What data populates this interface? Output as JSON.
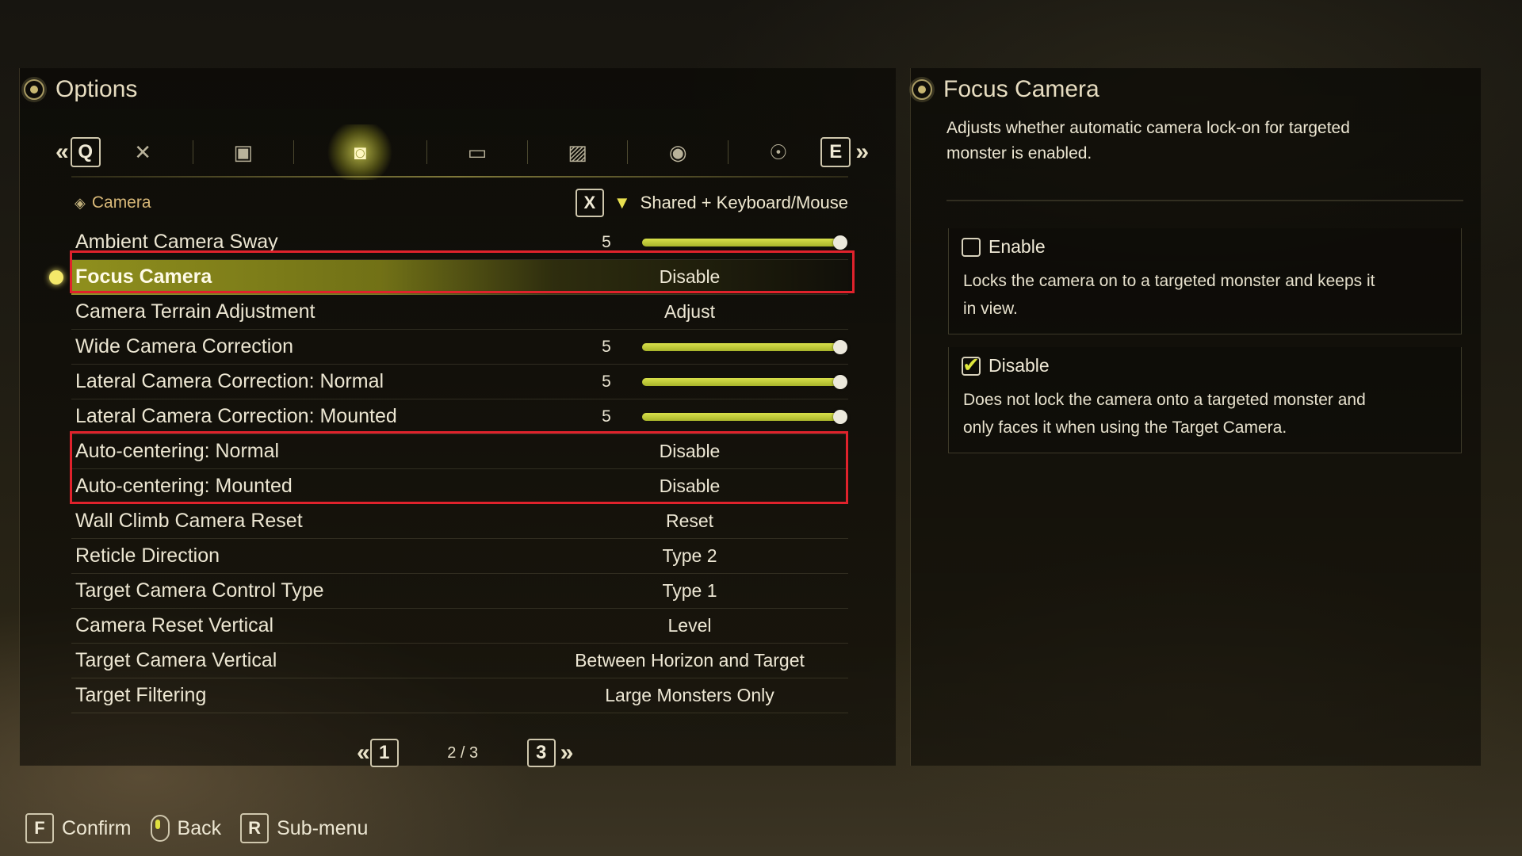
{
  "options": {
    "title": "Options"
  },
  "tabs": {
    "left_key": "Q",
    "right_key": "E",
    "prev_chevron": "«",
    "next_chevron": "»",
    "icons": [
      "crossed-swords-icon",
      "gamepad-icon",
      "camera-icon",
      "monitor-icon",
      "image-icon",
      "speaker-icon",
      "accessibility-icon"
    ],
    "active_index": 2
  },
  "section": {
    "label": "Camera",
    "filter_key": "X",
    "filter_text": "Shared + Keyboard/Mouse"
  },
  "settings": [
    {
      "label": "Ambient Camera Sway",
      "type": "slider",
      "value": "5",
      "level": 1.0
    },
    {
      "label": "Focus Camera",
      "type": "choice",
      "value": "Disable",
      "selected": true
    },
    {
      "label": "Camera Terrain Adjustment",
      "type": "choice",
      "value": "Adjust"
    },
    {
      "label": "Wide Camera Correction",
      "type": "slider",
      "value": "5",
      "level": 1.0
    },
    {
      "label": "Lateral Camera Correction: Normal",
      "type": "slider",
      "value": "5",
      "level": 1.0
    },
    {
      "label": "Lateral Camera Correction: Mounted",
      "type": "slider",
      "value": "5",
      "level": 1.0
    },
    {
      "label": "Auto-centering: Normal",
      "type": "choice",
      "value": "Disable"
    },
    {
      "label": "Auto-centering: Mounted",
      "type": "choice",
      "value": "Disable"
    },
    {
      "label": "Wall Climb Camera Reset",
      "type": "choice",
      "value": "Reset"
    },
    {
      "label": "Reticle Direction",
      "type": "choice",
      "value": "Type 2"
    },
    {
      "label": "Target Camera Control Type",
      "type": "choice",
      "value": "Type 1"
    },
    {
      "label": "Camera Reset Vertical",
      "type": "choice",
      "value": "Level"
    },
    {
      "label": "Target Camera Vertical",
      "type": "choice",
      "value": "Between Horizon and Target"
    },
    {
      "label": "Target Filtering",
      "type": "choice",
      "value": "Large Monsters Only"
    }
  ],
  "pagination": {
    "prev_key": "1",
    "next_key": "3",
    "text": "2 / 3",
    "prev_chevron": "«",
    "next_chevron": "»"
  },
  "detail": {
    "title": "Focus Camera",
    "description": "Adjusts whether automatic camera lock-on for targeted monster is enabled.",
    "options": [
      {
        "label": "Enable",
        "checked": false,
        "description": "Locks the camera on to a targeted monster and keeps it in view."
      },
      {
        "label": "Disable",
        "checked": true,
        "description": "Does not lock the camera onto a targeted monster and only faces it when using the Target Camera."
      }
    ]
  },
  "footer": {
    "confirm_key": "F",
    "confirm_label": "Confirm",
    "back_label": "Back",
    "submenu_key": "R",
    "submenu_label": "Sub-menu"
  },
  "colors": {
    "accent": "#d8e04a",
    "highlight_box": "#e0222c",
    "section_label": "#d8b878"
  }
}
